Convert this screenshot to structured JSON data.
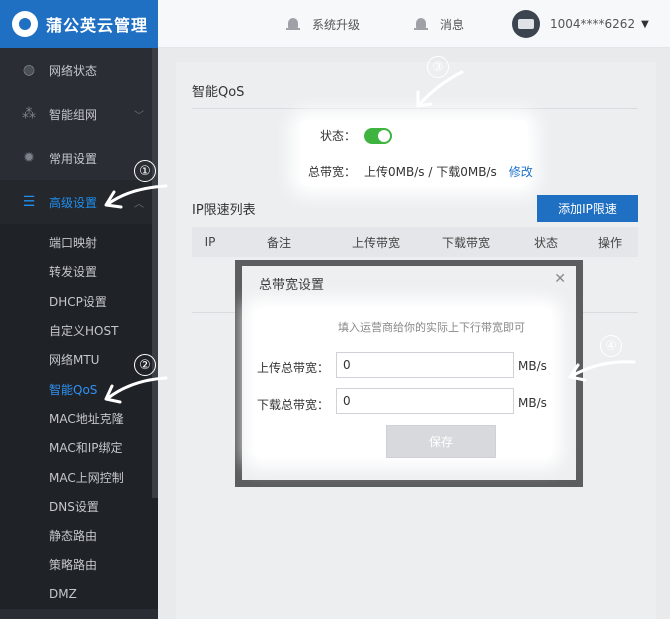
{
  "brand": {
    "name": "蒲公英云管理"
  },
  "sidebar": {
    "items": [
      {
        "label": "网络状态",
        "icon": "globe-icon"
      },
      {
        "label": "智能组网",
        "icon": "network-icon"
      },
      {
        "label": "常用设置",
        "icon": "gear-icon"
      },
      {
        "label": "高级设置",
        "icon": "menu-icon"
      }
    ],
    "sub_items": [
      "端口映射",
      "转发设置",
      "DHCP设置",
      "自定义HOST",
      "网络MTU",
      "智能QoS",
      "MAC地址克隆",
      "MAC和IP绑定",
      "MAC上网控制",
      "DNS设置",
      "静态路由",
      "策略路由",
      "DMZ"
    ]
  },
  "topbar": {
    "upgrade": "系统升级",
    "messages": "消息",
    "account": "1004****6262"
  },
  "qos": {
    "title": "智能QoS",
    "status_label": "状态：",
    "bandwidth_label": "总带宽：",
    "bandwidth_value": "上传0MB/s / 下载0MB/s",
    "edit_link": "修改"
  },
  "ip_limit": {
    "title": "IP限速列表",
    "add_button": "添加IP限速",
    "columns": [
      "IP",
      "备注",
      "上传带宽",
      "下载带宽",
      "状态",
      "操作"
    ]
  },
  "modal": {
    "title": "总带宽设置",
    "hint": "填入运营商给你的实际上下行带宽即可",
    "upload_label": "上传总带宽：",
    "upload_value": "0",
    "download_label": "下载总带宽：",
    "download_value": "0",
    "unit": "MB/s",
    "save": "保存"
  },
  "markers": [
    "①",
    "②",
    "③",
    "④"
  ],
  "colors": {
    "brand": "#1f6fc3",
    "toggle_on": "#3fb33f",
    "link": "#1f73c8",
    "active_text": "#2f93f5"
  }
}
